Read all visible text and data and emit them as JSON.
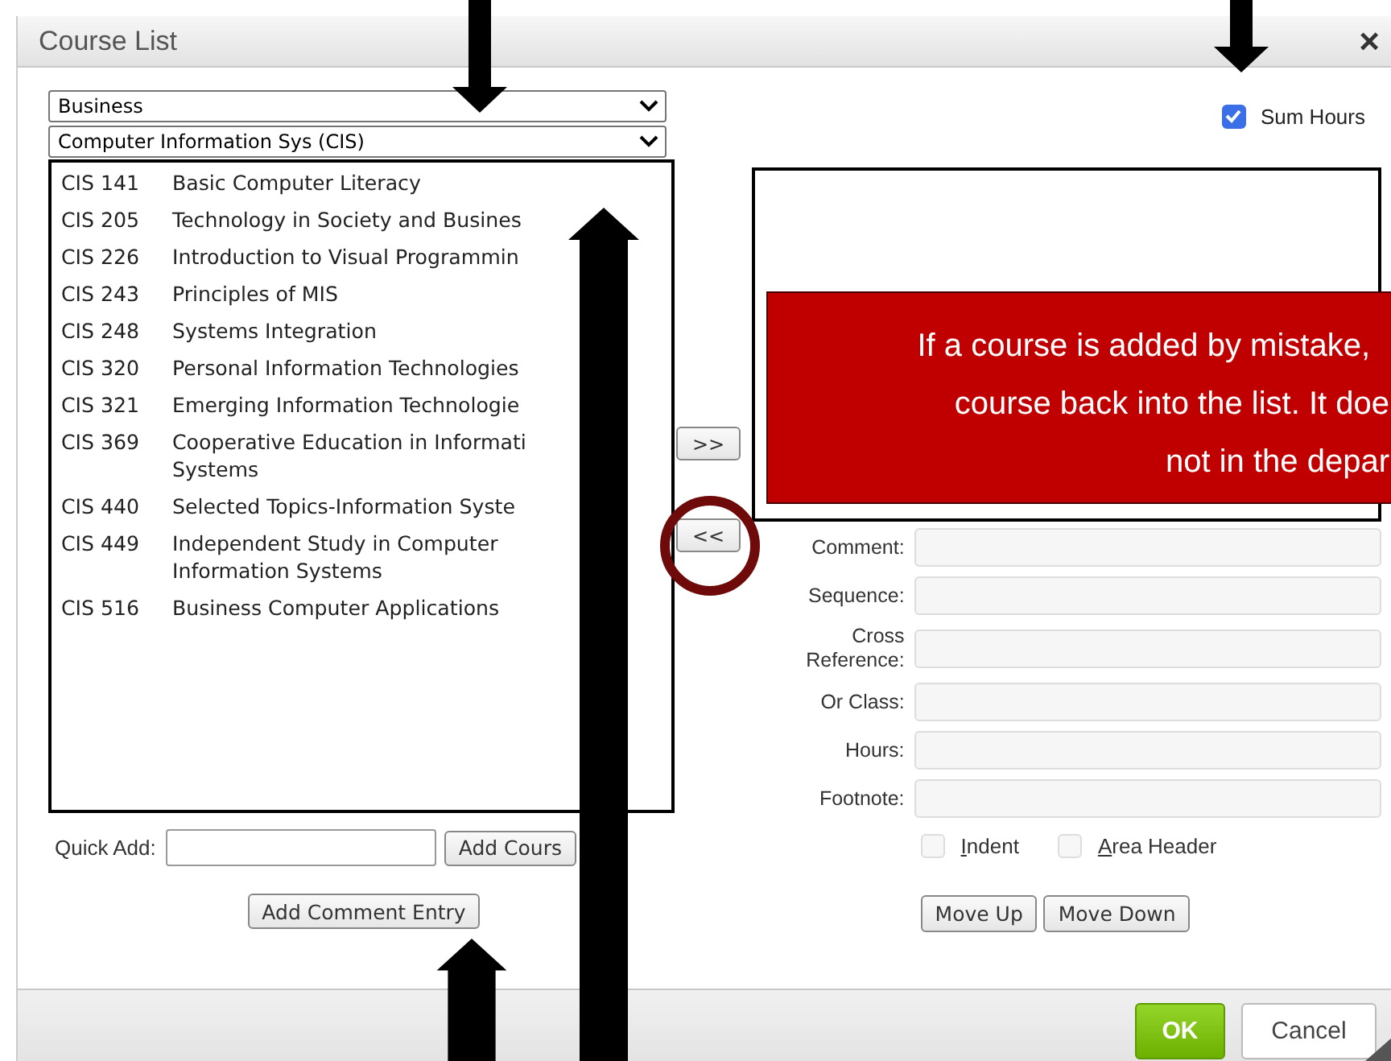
{
  "window": {
    "title": "Course List",
    "close": "×"
  },
  "department_select": {
    "value": "Business"
  },
  "subject_select": {
    "value": "Computer Information Sys (CIS)"
  },
  "courses": [
    {
      "code": "CIS 141",
      "title": "Basic Computer Literacy"
    },
    {
      "code": "CIS 205",
      "title": "Technology in Society and Busines"
    },
    {
      "code": "CIS 226",
      "title": "Introduction to Visual Programmin"
    },
    {
      "code": "CIS 243",
      "title": "Principles of MIS"
    },
    {
      "code": "CIS 248",
      "title": "Systems Integration"
    },
    {
      "code": "CIS 320",
      "title": "Personal Information Technologies"
    },
    {
      "code": "CIS 321",
      "title": "Emerging Information Technologie"
    },
    {
      "code": "CIS 369",
      "title": "Cooperative Education in Informati\nSystems"
    },
    {
      "code": "CIS 440",
      "title": "Selected Topics-Information Syste"
    },
    {
      "code": "CIS 449",
      "title": "Independent Study in Computer\nInformation Systems"
    },
    {
      "code": "CIS 516",
      "title": "Business Computer Applications"
    }
  ],
  "quick_add": {
    "label": "Quick Add:",
    "button": "Add Cours"
  },
  "add_comment_button": "Add Comment Entry",
  "move_buttons": {
    "add": ">>",
    "remove": "<<"
  },
  "sum_hours": {
    "label": "Sum Hours",
    "checked": true
  },
  "callout": {
    "lines": [
      "If a course is added by mistake,",
      "course back into the list. It doe",
      "not in the depar"
    ]
  },
  "fields": [
    {
      "label": "Comment:"
    },
    {
      "label": "Sequence:"
    },
    {
      "label": "Cross Reference:"
    },
    {
      "label": "Or Class:"
    },
    {
      "label": "Hours:"
    },
    {
      "label": "Footnote:"
    }
  ],
  "options": [
    {
      "label": "Indent",
      "checked": false
    },
    {
      "label": "Area Header",
      "checked": false
    }
  ],
  "order_buttons": [
    "Move Up",
    "Move Down"
  ],
  "footer": {
    "ok": "OK",
    "cancel": "Cancel"
  }
}
